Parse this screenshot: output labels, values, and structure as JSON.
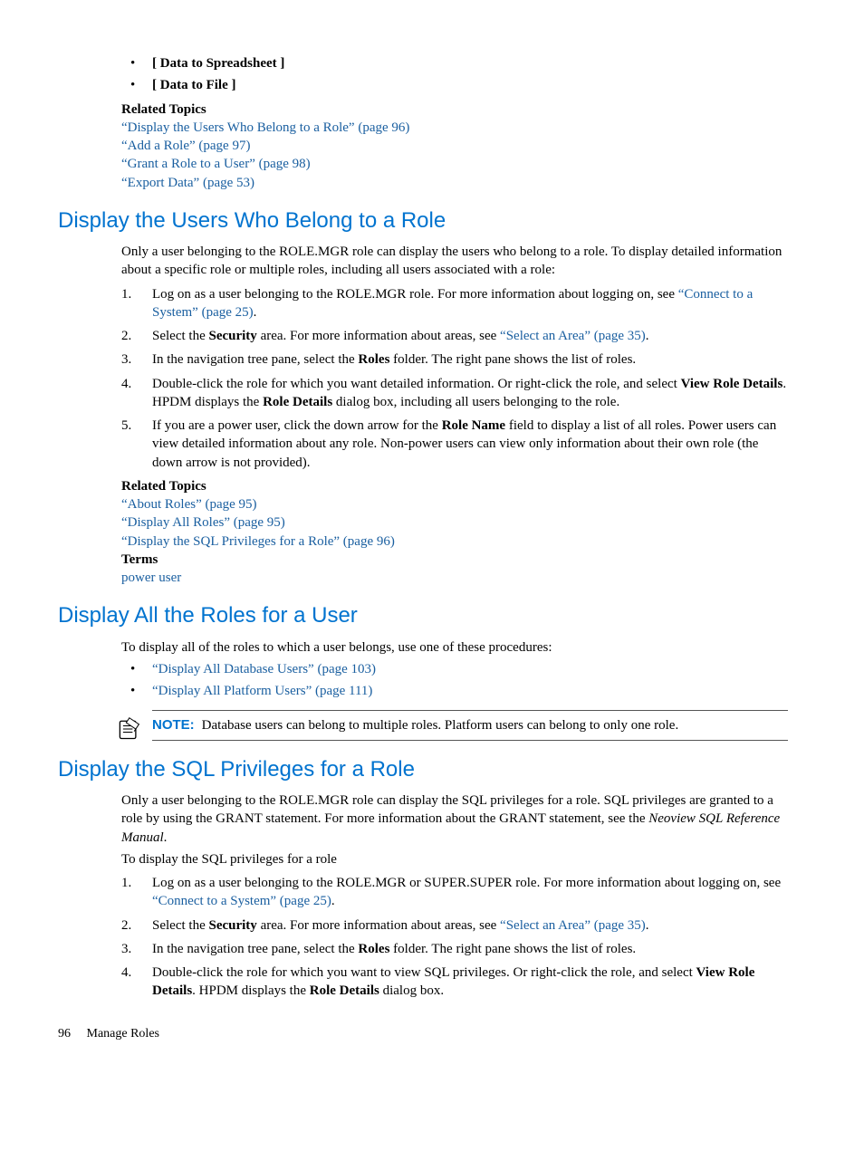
{
  "top_bullets": [
    "[ Data to Spreadsheet ]",
    "[ Data to File ]"
  ],
  "top_related_label": "Related Topics",
  "top_related": [
    "“Display the Users Who Belong to a Role” (page 96)",
    "“Add a Role” (page 97)",
    "“Grant a Role to a User” (page 98)",
    "“Export Data” (page 53)"
  ],
  "sec1": {
    "heading": "Display the Users Who Belong to a Role",
    "intro": "Only a user belonging to the ROLE.MGR role can display the users who belong to a role. To display detailed information about a specific role or multiple roles, including all users associated with a role:",
    "step1_a": "Log on as a user belonging to the ROLE.MGR role. For more information about logging on, see ",
    "step1_link": "“Connect to a System” (page 25)",
    "step1_b": ".",
    "step2_a": "Select the ",
    "step2_bold": "Security",
    "step2_b": " area. For more information about areas, see ",
    "step2_link": "“Select an Area” (page 35)",
    "step2_c": ".",
    "step3_a": "In the navigation tree pane, select the ",
    "step3_bold": "Roles",
    "step3_b": " folder. The right pane shows the list of roles.",
    "step4_a": "Double-click the role for which you want detailed information. Or right-click the role, and select ",
    "step4_bold1": "View Role Details",
    "step4_b": ". HPDM displays the ",
    "step4_bold2": "Role Details",
    "step4_c": " dialog box, including all users belonging to the role.",
    "step5_a": "If you are a power user, click the down arrow for the ",
    "step5_bold": "Role Name",
    "step5_b": " field to display a list of all roles. Power users can view detailed information about any role. Non-power users can view only information about their own role (the down arrow is not provided).",
    "related_label": "Related Topics",
    "related": [
      "“About Roles” (page 95)",
      "“Display All Roles” (page 95)",
      "“Display the SQL Privileges for a Role” (page 96)"
    ],
    "terms_label": "Terms",
    "terms_link": "power user"
  },
  "sec2": {
    "heading": "Display All the Roles for a User",
    "intro": "To display all of the roles to which a user belongs, use one of these procedures:",
    "bullets": [
      "“Display All Database Users” (page 103)",
      "“Display All Platform Users” (page 111)"
    ],
    "note_label": "NOTE:",
    "note_text": "Database users can belong to multiple roles. Platform users can belong to only one role."
  },
  "sec3": {
    "heading": "Display the SQL Privileges for a Role",
    "intro_a": "Only a user belonging to the ROLE.MGR role can display the SQL privileges for a role. SQL privileges are granted to a role by using the GRANT statement. For more information about the GRANT statement, see the ",
    "intro_italic": "Neoview SQL Reference Manual",
    "intro_b": ".",
    "sub": "To display the SQL privileges for a role",
    "step1_a": "Log on as a user belonging to the ROLE.MGR or SUPER.SUPER role. For more information about logging on, see ",
    "step1_link": "“Connect to a System” (page 25)",
    "step1_b": ".",
    "step2_a": "Select the ",
    "step2_bold": "Security",
    "step2_b": " area. For more information about areas, see ",
    "step2_link": "“Select an Area” (page 35)",
    "step2_c": ".",
    "step3_a": "In the navigation tree pane, select the ",
    "step3_bold": "Roles",
    "step3_b": " folder. The right pane shows the list of roles.",
    "step4_a": "Double-click the role for which you want to view SQL privileges. Or right-click the role, and select ",
    "step4_bold1": "View Role Details",
    "step4_b": ". HPDM displays the ",
    "step4_bold2": "Role Details",
    "step4_c": " dialog box."
  },
  "footer": {
    "page": "96",
    "title": "Manage Roles"
  }
}
